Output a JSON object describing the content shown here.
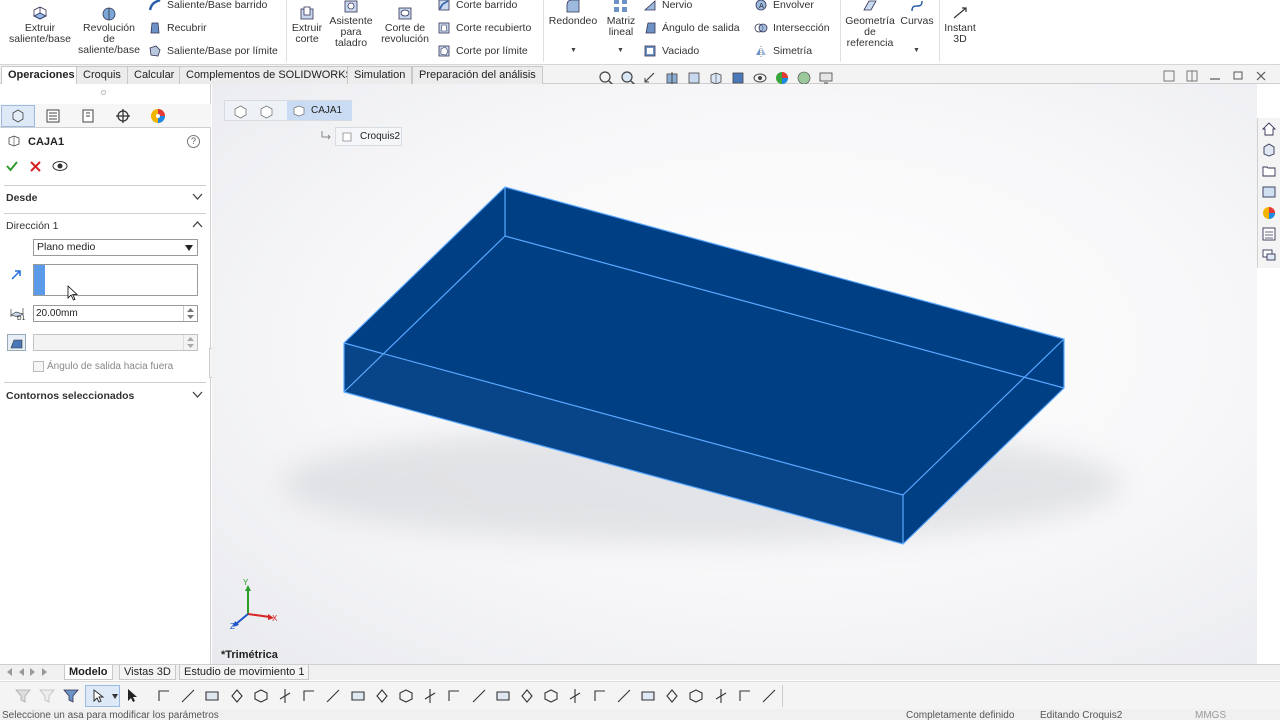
{
  "ribbon": {
    "extrude_boss_l1": "Extruir",
    "extrude_boss_l2": "saliente/base",
    "revolve_boss_l1": "Revolución",
    "revolve_boss_l2": "de",
    "revolve_boss_l3": "saliente/base",
    "swept_boss": "Saliente/Base barrido",
    "recubrir": "Recubrir",
    "boundary_boss": "Saliente/Base por límite",
    "extruded_cut_l1": "Extruir",
    "extruded_cut_l2": "corte",
    "hole_wizard_l1": "Asistente",
    "hole_wizard_l2": "para",
    "hole_wizard_l3": "taladro",
    "revolved_cut_l1": "Corte de",
    "revolved_cut_l2": "revolución",
    "swept_cut": "Corte barrido",
    "lofted_cut": "Corte recubierto",
    "boundary_cut": "Corte por límite",
    "fillet": "Redondeo",
    "linear_pattern_l1": "Matriz",
    "linear_pattern_l2": "lineal",
    "rib": "Nervio",
    "draft": "Ángulo de salida",
    "shell": "Vaciado",
    "wrap": "Envolver",
    "intersect": "Intersección",
    "mirror": "Simetría",
    "ref_geometry_l1": "Geometría",
    "ref_geometry_l2": "de",
    "ref_geometry_l3": "referencia",
    "curves": "Curvas",
    "instant3d_l1": "Instant",
    "instant3d_l2": "3D"
  },
  "tabs": [
    "Operaciones",
    "Croquis",
    "Calcular",
    "Complementos de SOLIDWORKS",
    "Simulation",
    "Preparación del análisis"
  ],
  "feature_tree": {
    "item": "CAJA1",
    "sketch": "Croquis2"
  },
  "property_manager": {
    "title": "CAJA1",
    "help": "?",
    "desde_label": "Desde",
    "direction_label": "Dirección 1",
    "end_condition": "Plano medio",
    "depth_value": "20.00mm",
    "draft_outward_label": "Ángulo de salida hacia fuera",
    "contours_label": "Contornos seleccionados"
  },
  "viewport": {
    "view_name": "*Trimétrica",
    "axis_y": "Y",
    "axis_x": "X",
    "axis_z": "Z",
    "model_color": "#003f84",
    "edge_color": "#5aa8ff"
  },
  "bottom_tabs": [
    "Modelo",
    "Vistas 3D",
    "Estudio de movimiento 1"
  ],
  "status": {
    "message": "Seleccione un asa para modificar los parámetros",
    "definition": "Completamente definido",
    "editing": "Editando Croquis2",
    "units": "MMGS"
  },
  "colors": {
    "accent_blue": "#1e6fd9",
    "confirm_green": "#2e9b2e",
    "cancel_red": "#d42020"
  }
}
